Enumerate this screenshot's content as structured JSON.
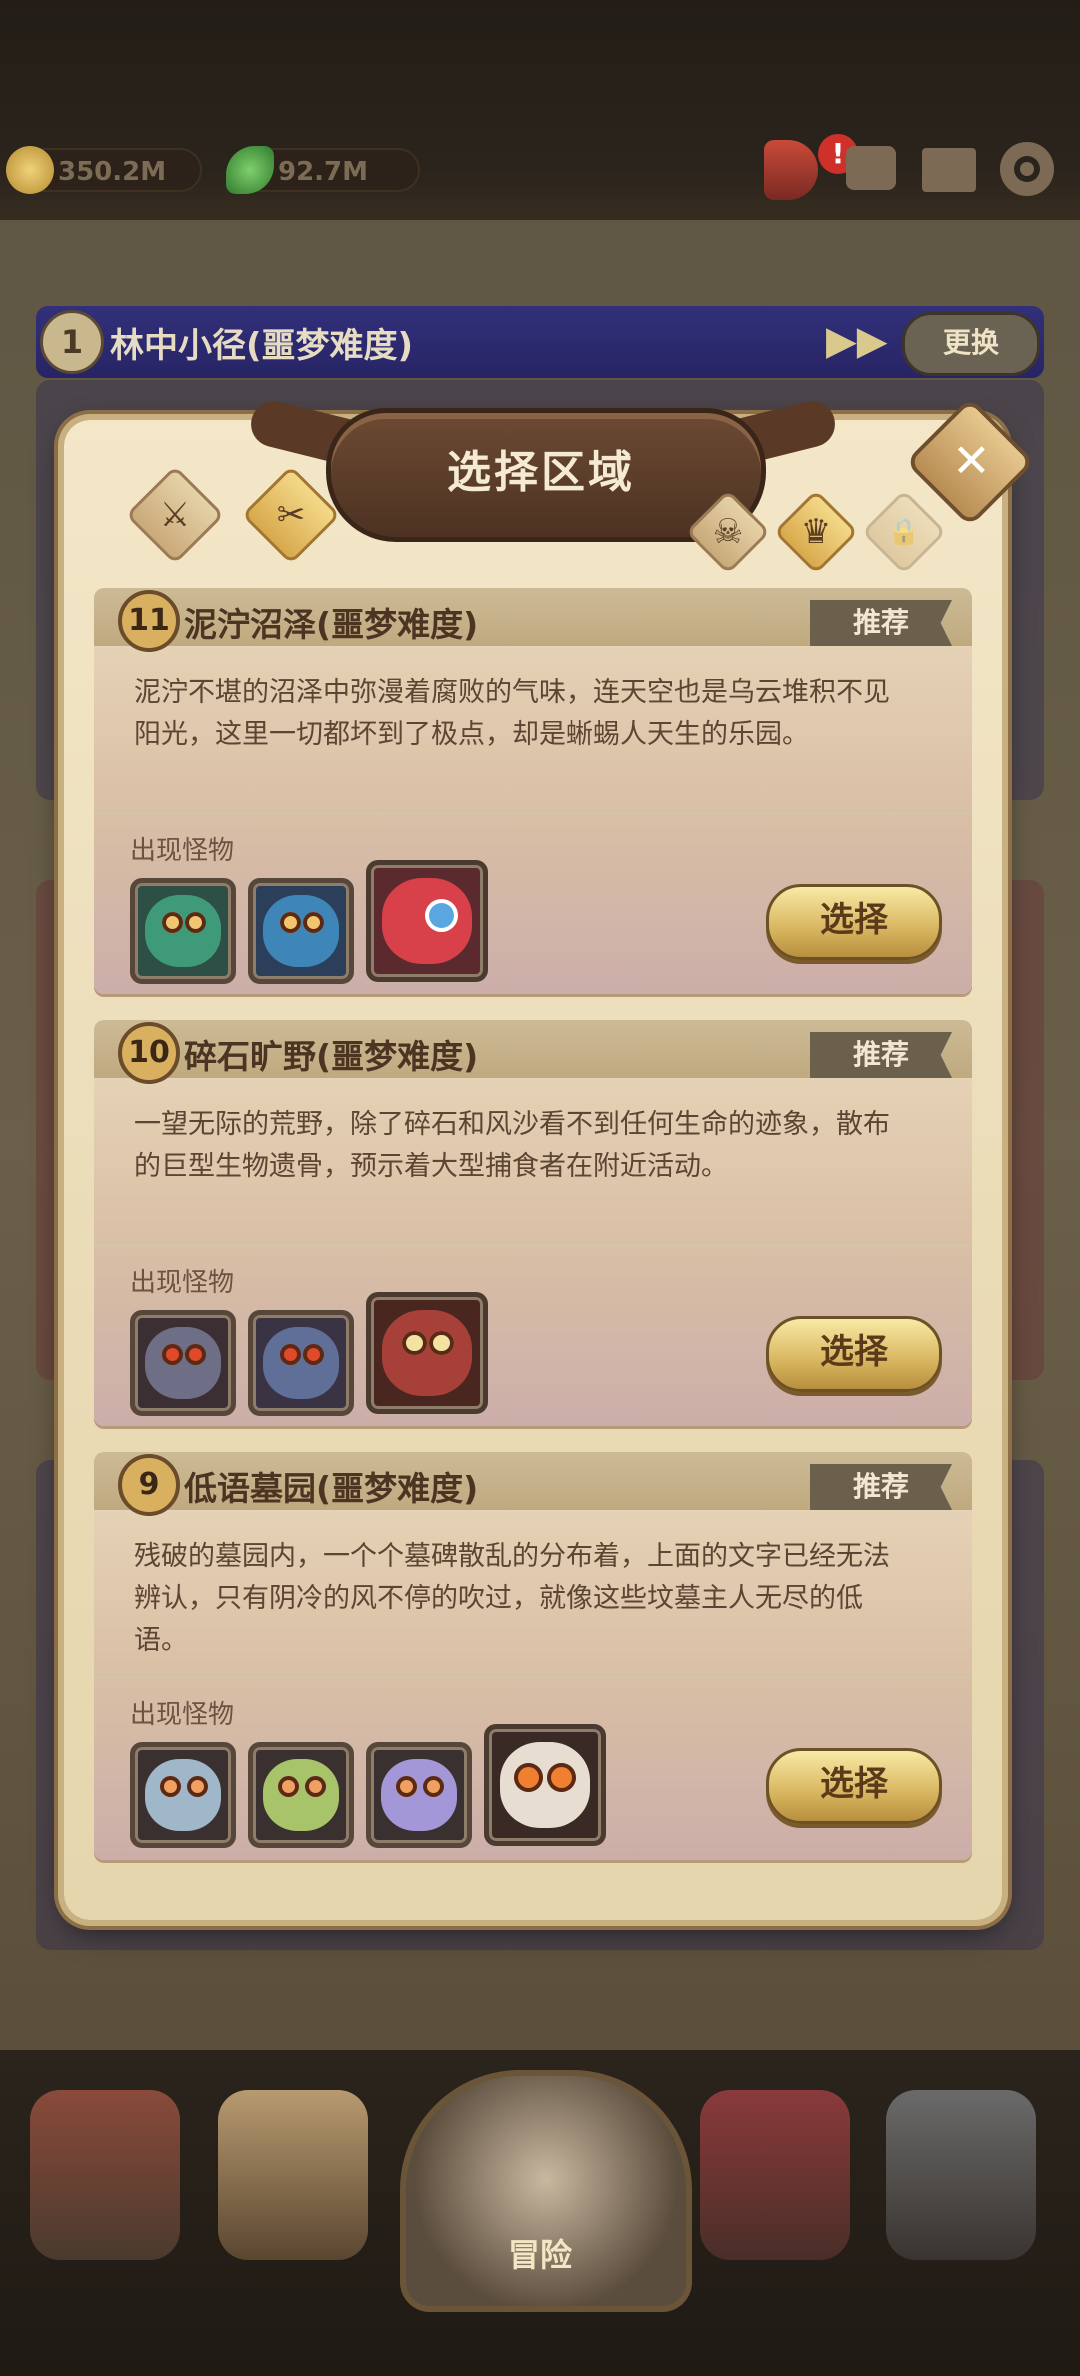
{
  "top_bar": {
    "coins": "350.2M",
    "gems": "92.7M",
    "icons": [
      "coin-icon",
      "leaf-gem-icon",
      "horn-icon",
      "alert-icon",
      "chat-icon",
      "mail-icon",
      "gear-icon"
    ],
    "alert_mark": "!"
  },
  "background": {
    "stage_number": "1",
    "stage_title": "林中小径(噩梦难度)",
    "change_label": "更换",
    "fast_forward_glyph": "▶▶"
  },
  "panel": {
    "title": "选择区域",
    "close_glyph": "✕",
    "left_tabs": [
      {
        "name": "sword-tab-icon",
        "glyph": "⚔"
      },
      {
        "name": "crossed-swords-tab-icon",
        "glyph": "✂"
      }
    ],
    "difficulty_tabs": [
      {
        "name": "skull-tab-icon",
        "glyph": "☠",
        "state": "normal"
      },
      {
        "name": "demon-tab-icon",
        "glyph": "♛",
        "state": "selected"
      },
      {
        "name": "lock-tab-icon",
        "glyph": "🔒",
        "state": "locked"
      }
    ]
  },
  "areas": [
    {
      "number": "11",
      "title": "泥泞沼泽(噩梦难度)",
      "tag": "推荐",
      "desc_lines": [
        "泥泞不堪的沼泽中弥漫着腐败的气味，连天空也是乌云堆积不见",
        "阳光，这里一切都坏到了极点，却是蜥蜴人天生的乐园。"
      ],
      "monster_label": "出现怪物",
      "monsters": [
        {
          "name": "green-lizard-monster-icon",
          "color": "#3f9a7a",
          "boss": false
        },
        {
          "name": "blue-lizard-monster-icon",
          "color": "#3f86b8",
          "boss": false
        },
        {
          "name": "red-dragon-boss-monster-icon",
          "color": "#d8414a",
          "boss": true
        }
      ],
      "button": "选择"
    },
    {
      "number": "10",
      "title": "碎石旷野(噩梦难度)",
      "tag": "推荐",
      "desc_lines": [
        "一望无际的荒野，除了碎石和风沙看不到任何生命的迹象，散布",
        "的巨型生物遗骨，预示着大型捕食者在附近活动。"
      ],
      "monster_label": "出现怪物",
      "monsters": [
        {
          "name": "grey-boar-monster-icon",
          "color": "#6e6f86",
          "boss": false
        },
        {
          "name": "blue-boar-monster-icon",
          "color": "#5f6f98",
          "boss": false
        },
        {
          "name": "red-boar-boss-monster-icon",
          "color": "#a8403a",
          "boss": true
        }
      ],
      "button": "选择"
    },
    {
      "number": "9",
      "title": "低语墓园(噩梦难度)",
      "tag": "推荐",
      "desc_lines": [
        "残破的墓园内，一个个墓碑散乱的分布着，上面的文字已经无法",
        "辨认，只有阴冷的风不停的吹过，就像这些坟墓主人无尽的低",
        "语。"
      ],
      "monster_label": "出现怪物",
      "monsters": [
        {
          "name": "blue-skull-monster-icon",
          "color": "#9fb7c8",
          "boss": false
        },
        {
          "name": "green-skull-monster-icon",
          "color": "#a8c46a",
          "boss": false
        },
        {
          "name": "purple-skull-monster-icon",
          "color": "#a497d8",
          "boss": false
        },
        {
          "name": "crowned-skull-boss-monster-icon",
          "color": "#e7ddd0",
          "boss": true
        }
      ],
      "button": "选择"
    }
  ],
  "bottom_nav": {
    "center_label": "冒险",
    "items": [
      "house-nav-icon",
      "tavern-nav-icon",
      "adventure-nav-icon",
      "treasure-nav-icon",
      "forge-nav-icon"
    ]
  }
}
